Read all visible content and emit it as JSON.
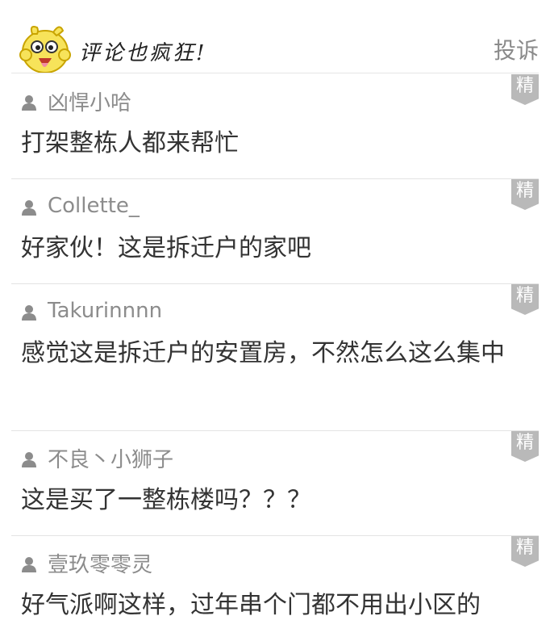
{
  "header": {
    "title": "评论也疯狂!",
    "report_label": "投诉",
    "mascot_icon": "yellow-cartoon-face-icon"
  },
  "badge_label": "精",
  "comments": [
    {
      "username": "凶悍小哈",
      "text": "打架整栋人都来帮忙",
      "featured": true
    },
    {
      "username": "Collette_",
      "text": "好家伙！这是拆迁户的家吧",
      "featured": true
    },
    {
      "username": "Takurinnnn",
      "text": "感觉这是拆迁户的安置房，不然怎么这么集中",
      "featured": true
    },
    {
      "username": "不良丶小狮子",
      "text": "这是买了一整栋楼吗？？？",
      "featured": true
    },
    {
      "username": "壹玖零零灵",
      "text": "好气派啊这样，过年串个门都不用出小区的",
      "featured": true
    }
  ],
  "colors": {
    "badge": "#b9b9b9",
    "username": "#8c8c8c",
    "text": "#333333",
    "divider": "#e3e3e3",
    "mascot_yellow": "#f7e35a"
  }
}
